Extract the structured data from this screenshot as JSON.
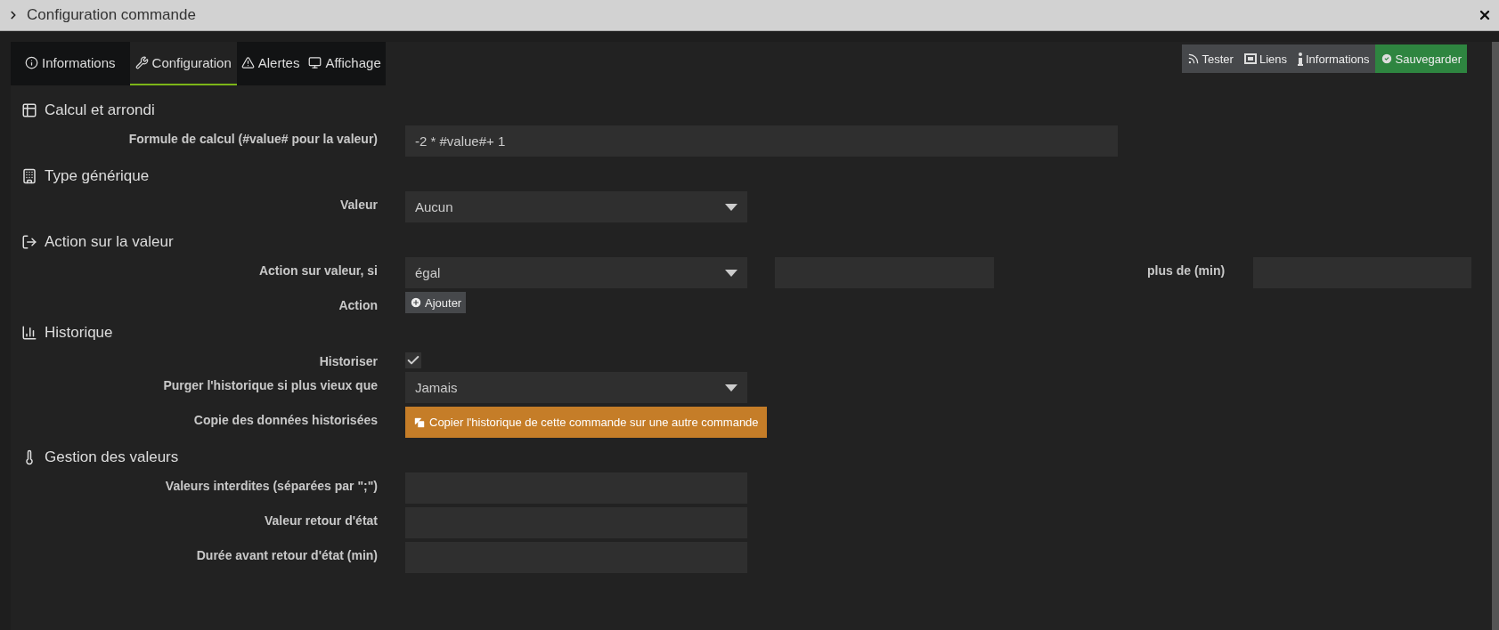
{
  "window": {
    "title": "Configuration commande"
  },
  "tabs": [
    {
      "label": "Informations",
      "selected": false
    },
    {
      "label": "Configuration",
      "selected": true
    },
    {
      "label": "Alertes",
      "selected": false
    },
    {
      "label": "Affichage",
      "selected": false
    }
  ],
  "actions": [
    {
      "label": "Tester",
      "kind": "plain"
    },
    {
      "label": "Liens",
      "kind": "plain"
    },
    {
      "label": "Informations",
      "kind": "plain"
    },
    {
      "label": "Sauvegarder",
      "kind": "success"
    }
  ],
  "sections": [
    {
      "title": "Calcul et arrondi",
      "rows": [
        {
          "kind": "wide-input",
          "label": "Formule de calcul (#value# pour la valeur)",
          "value": "-2 * #value#+ 1"
        }
      ]
    },
    {
      "title": "Type générique",
      "rows": [
        {
          "kind": "select",
          "label": "Valeur",
          "value": "Aucun"
        }
      ]
    },
    {
      "title": "Action sur la valeur",
      "rows": [
        {
          "kind": "condition",
          "label": "Action sur valeur, si",
          "value": "égal",
          "extra_label": "plus de (min)"
        },
        {
          "kind": "add-button",
          "label": "Action",
          "button": "Ajouter"
        }
      ]
    },
    {
      "title": "Historique",
      "rows": [
        {
          "kind": "checkbox",
          "label": "Historiser",
          "checked": true
        },
        {
          "kind": "select",
          "label": "Purger l'historique si plus vieux que",
          "value": "Jamais"
        },
        {
          "kind": "copy-button",
          "label": "Copie des données historisées",
          "button": "Copier l'historique de cette commande sur une autre commande"
        }
      ]
    },
    {
      "title": "Gestion des valeurs",
      "rows": [
        {
          "kind": "input",
          "label": "Valeurs interdites (séparées par \";\")"
        },
        {
          "kind": "input",
          "label": "Valeur retour d'état"
        },
        {
          "kind": "input",
          "label": "Durée avant retour d'état (min)"
        }
      ]
    }
  ]
}
